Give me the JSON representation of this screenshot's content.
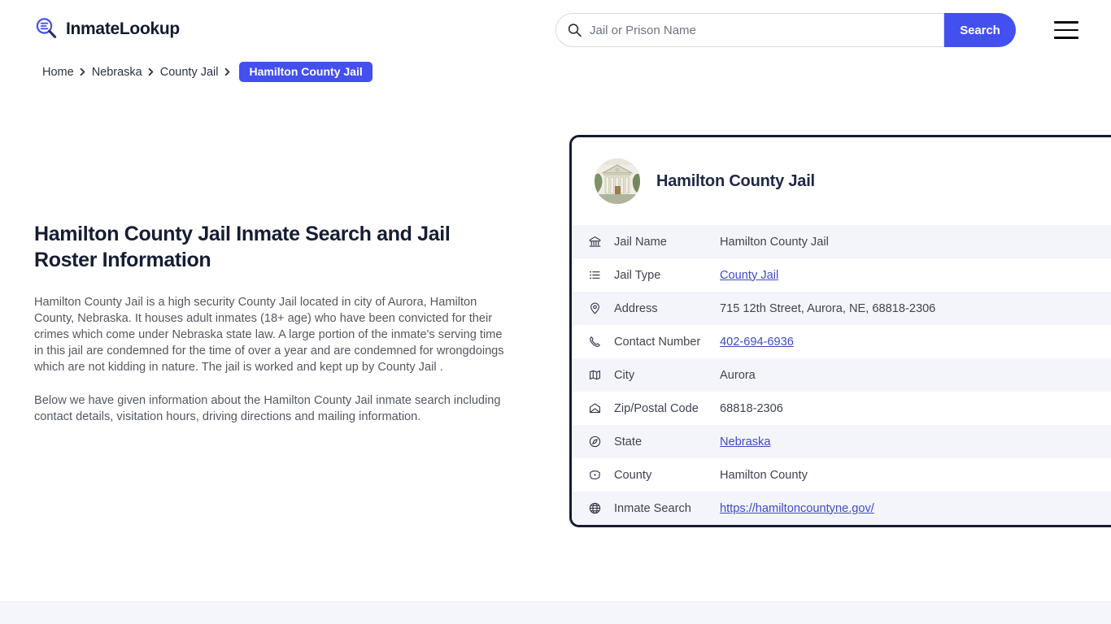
{
  "header": {
    "brand_name": "InmateLookup",
    "brand_icon": "magnifier-list-icon",
    "search": {
      "placeholder": "Jail or Prison Name",
      "value": "",
      "button_label": "Search",
      "icon": "search-icon"
    },
    "menu_icon": "hamburger-menu-icon",
    "accent_color": "#4350ef"
  },
  "breadcrumb": {
    "items": [
      {
        "label": "Home",
        "current": false
      },
      {
        "label": "Nebraska",
        "current": false
      },
      {
        "label": "County Jail",
        "current": false
      },
      {
        "label": "Hamilton County Jail",
        "current": true
      }
    ],
    "separator_icon": "chevron-right-icon"
  },
  "main": {
    "title": "Hamilton County Jail Inmate Search and Jail Roster Information",
    "paragraph_1": "Hamilton County Jail is a high security County Jail located in city of Aurora, Hamilton County, Nebraska. It houses adult inmates (18+ age) who have been convicted for their crimes which come under Nebraska state law. A large portion of the inmate's serving time in this jail are condemned for the time of over a year and are condemned for wrongdoings which are not kidding in nature. The jail is worked and kept up by County Jail .",
    "paragraph_2": "Below we have given information about the Hamilton County Jail inmate search including contact details, visitation hours, driving directions and mailing information."
  },
  "info_card": {
    "avatar_icon": "courthouse-photo",
    "title": "Hamilton County Jail",
    "rows": [
      {
        "icon": "bank-building-icon",
        "label": "Jail Name",
        "value": "Hamilton County Jail",
        "link": false
      },
      {
        "icon": "list-icon",
        "label": "Jail Type",
        "value": "County Jail",
        "link": true
      },
      {
        "icon": "map-pin-icon",
        "label": "Address",
        "value": "715 12th Street, Aurora, NE, 68818-2306",
        "link": false
      },
      {
        "icon": "phone-icon",
        "label": "Contact Number",
        "value": "402-694-6936",
        "link": true
      },
      {
        "icon": "map-icon",
        "label": "City",
        "value": "Aurora",
        "link": false
      },
      {
        "icon": "envelope-icon",
        "label": "Zip/Postal Code",
        "value": "68818-2306",
        "link": false
      },
      {
        "icon": "compass-icon",
        "label": "State",
        "value": "Nebraska",
        "link": true
      },
      {
        "icon": "county-map-icon",
        "label": "County",
        "value": "Hamilton County",
        "link": false
      },
      {
        "icon": "globe-icon",
        "label": "Inmate Search",
        "value": "https://hamiltoncountyne.gov/",
        "link": true
      }
    ],
    "border_color": "#151c2e",
    "alt_row_color": "#f4f5fb",
    "link_color": "#3c4bc7"
  }
}
